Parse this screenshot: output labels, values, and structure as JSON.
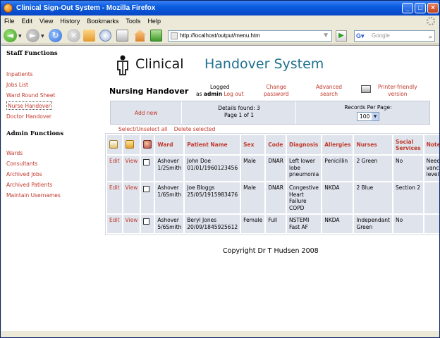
{
  "window": {
    "title": "Clinical Sign-Out System - Mozilla Firefox"
  },
  "menu": [
    "File",
    "Edit",
    "View",
    "History",
    "Bookmarks",
    "Tools",
    "Help"
  ],
  "nav": {
    "url": "http://localhost/output/menu.htm",
    "search_placeholder": "Google"
  },
  "sidebar": {
    "staff_heading": "Staff Functions",
    "staff_links": [
      "Inpatients",
      "Jobs List",
      "Ward Round Sheet",
      "Nurse Handover",
      "Doctor Handover"
    ],
    "admin_heading": "Admin Functions",
    "admin_links": [
      "Wards",
      "Consultants",
      "Archived Jobs",
      "Archived Patients",
      "Maintain Usernames"
    ]
  },
  "logo": {
    "word1": "Clinical",
    "word2": "Handover System"
  },
  "page": {
    "title": "Nursing Handover",
    "logged_line1": "Logged",
    "logged_as": "as",
    "user": "admin",
    "logout": "Log out",
    "change_password": [
      "Change",
      "password"
    ],
    "advanced_search": [
      "Advanced",
      "search"
    ],
    "printer_friendly": [
      "Printer-friendly",
      "version"
    ]
  },
  "stats": {
    "add_new": "Add new",
    "details_found": "Details found: 3",
    "page_info": "Page 1 of 1",
    "records_per_page_label": "Records Per Page:",
    "records_per_page_value": "100"
  },
  "selection": {
    "select_all": "Select/Unselect all",
    "delete_selected": "Delete selected"
  },
  "table": {
    "headers": [
      "Ward",
      "Patient Name",
      "Sex",
      "Code",
      "Diagnosis",
      "Allergies",
      "Nurses",
      "Social Services",
      "Notes"
    ],
    "edit_label": "Edit",
    "view_label": "View",
    "rows": [
      {
        "ward": [
          "Ashover",
          "1/2Smith"
        ],
        "patient": [
          "John Doe",
          "01/01/1960123456"
        ],
        "sex": "Male",
        "code": "DNAR",
        "diagnosis": [
          "Left lower",
          "lobe",
          "pneumonia"
        ],
        "allergies": "Penicillin",
        "nurses": [
          "2 Green"
        ],
        "social": "No",
        "notes": [
          "Needs IV",
          "vancomycin",
          "levels daily"
        ]
      },
      {
        "ward": [
          "Ashover",
          "1/6Smith"
        ],
        "patient": [
          "Joe Bloggs",
          "25/05/1915983476"
        ],
        "sex": "Male",
        "code": "DNAR",
        "diagnosis": [
          "Congestive",
          "Heart Failure",
          "COPD"
        ],
        "allergies": "NKDA",
        "nurses": [
          "2 Blue"
        ],
        "social": "Section 2",
        "notes": [
          ""
        ]
      },
      {
        "ward": [
          "Ashover",
          "5/6Smith"
        ],
        "patient": [
          "Beryl Jones",
          "20/09/1845925612"
        ],
        "sex": "Female",
        "code": "Full",
        "diagnosis": [
          "NSTEMI",
          "Fast AF"
        ],
        "allergies": "NKDA",
        "nurses": [
          "Independant",
          "Green"
        ],
        "social": "No",
        "notes": [
          ""
        ]
      }
    ]
  },
  "footer": {
    "copyright": "Copyright Dr T Hudsen 2008"
  },
  "colors": {
    "link": "#c0392b",
    "header_bg": "#dfe3ec",
    "logo_blue": "#1f7090"
  }
}
